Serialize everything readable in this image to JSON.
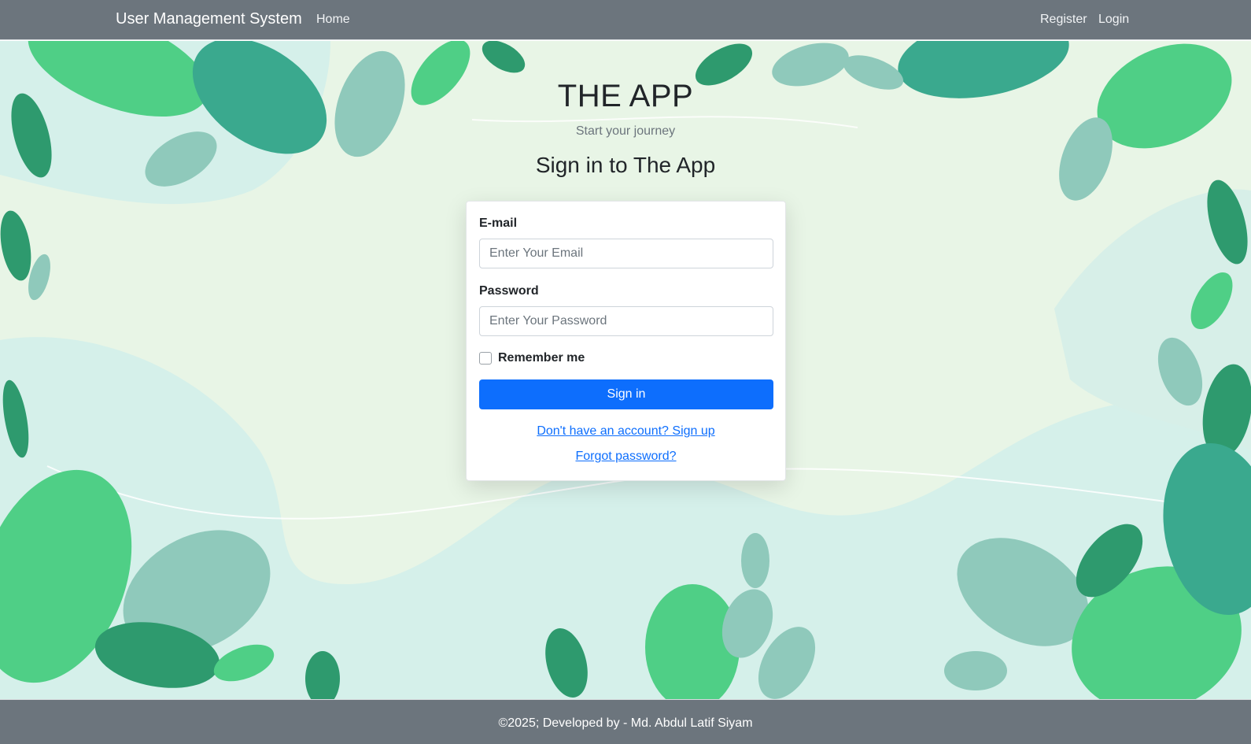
{
  "navbar": {
    "brand": "User Management System",
    "links": [
      "Home"
    ],
    "right_links": [
      "Register",
      "Login"
    ]
  },
  "hero": {
    "title": "THE APP",
    "subtitle": "Start your journey",
    "heading": "Sign in to The App"
  },
  "form": {
    "email_label": "E-mail",
    "email_placeholder": "Enter Your Email",
    "email_value": "",
    "password_label": "Password",
    "password_placeholder": "Enter Your Password",
    "password_value": "",
    "remember_label": "Remember me",
    "remember_checked": false,
    "submit_label": "Sign in",
    "signup_link": "Don't have an account? Sign up",
    "forgot_link": "Forgot password?"
  },
  "footer": {
    "text": "©2025; Developed by - Md. Abdul Latif Siyam"
  },
  "colors": {
    "navbar_bg": "#6c757d",
    "primary": "#0d6efd",
    "hero_bg": "#e8f5e6",
    "leaf_dark": "#2e9a6e",
    "leaf_light": "#4fcf86"
  }
}
